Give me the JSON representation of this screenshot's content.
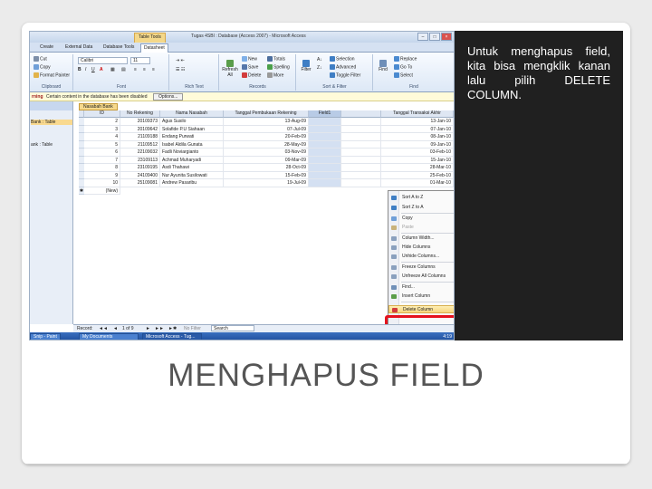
{
  "slide": {
    "description": "Untuk menghapus field, kita bisa mengklik kanan lalu pilih DELETE COLUMN.",
    "title": "MENGHAPUS FIELD"
  },
  "app": {
    "window_title": "Tugas 4SBI : Database (Access 2007) - Microsoft Access",
    "contextual_group": "Table Tools",
    "tabs": [
      "Create",
      "External Data",
      "Database Tools",
      "Datasheet"
    ],
    "ribbon": {
      "font_name": "Calibri",
      "font_size": "11",
      "groups": [
        "Clipboard",
        "Font",
        "Rich Text",
        "Records",
        "Sort & Filter",
        "Find"
      ],
      "items": {
        "cut": "Cut",
        "copy": "Copy",
        "format_painter": "Format Painter",
        "refresh": "Refresh All",
        "new": "New",
        "save": "Save",
        "delete": "Delete",
        "totals": "Totals",
        "spelling": "Spelling",
        "more": "More",
        "filter": "Filter",
        "selection": "Selection",
        "advanced": "Advanced",
        "toggle_filter": "Toggle Filter",
        "find": "Find",
        "replace": "Replace",
        "goto": "Go To",
        "select": "Select"
      }
    },
    "message_bar": {
      "warning": "rning",
      "message": "Certain content in the database has been disabled",
      "options": "Options..."
    },
    "nav_pane": {
      "items": [
        "Bank : Table",
        "ank : Table"
      ]
    },
    "doc_tab": "Nasabah Bank",
    "table": {
      "columns": [
        "ID",
        "No Rekening",
        "Nama Nasabah",
        "Tanggal Pembukaan Rekening",
        "Field1",
        "",
        "Tanggal Transaksi Akhir"
      ],
      "rows": [
        {
          "id": "2",
          "rek": "20109373",
          "nama": "Agus Susilo",
          "tgl": "13-Aug-09",
          "akhir": "13-Jan-10"
        },
        {
          "id": "3",
          "rek": "20109642",
          "nama": "Solafide P.U Siahaan",
          "tgl": "07-Jul-09",
          "akhir": "07-Jan-10"
        },
        {
          "id": "4",
          "rek": "21109188",
          "nama": "Endang Purwati",
          "tgl": "20-Feb-09",
          "akhir": "08-Jan-10"
        },
        {
          "id": "5",
          "rek": "21109512",
          "nama": "Isabel Aldila Gunata",
          "tgl": "28-May-09",
          "akhir": "09-Jan-10"
        },
        {
          "id": "6",
          "rek": "22109032",
          "nama": "Fadli Noviargianto",
          "tgl": "03-Nov-09",
          "akhir": "03-Feb-10"
        },
        {
          "id": "7",
          "rek": "23109113",
          "nama": "Achmad Muharyadi",
          "tgl": "09-Mar-09",
          "akhir": "15-Jan-10"
        },
        {
          "id": "8",
          "rek": "23109195",
          "nama": "Asdi Thahawi",
          "tgl": "28-Oct-09",
          "akhir": "28-Mar-10"
        },
        {
          "id": "9",
          "rek": "24109400",
          "nama": "Nur Ayunita Susilowati",
          "tgl": "15-Feb-09",
          "akhir": "25-Feb-10"
        },
        {
          "id": "10",
          "rek": "25109081",
          "nama": "Andrew Pasaribu",
          "tgl": "19-Jul-09",
          "akhir": "01-Mar-10"
        }
      ],
      "new_row": "(New)"
    },
    "context_menu": {
      "items": [
        {
          "label": "Sort A to Z",
          "disabled": false
        },
        {
          "label": "Sort Z to A",
          "disabled": false
        },
        {
          "label": "Copy",
          "disabled": false
        },
        {
          "label": "Paste",
          "disabled": true
        },
        {
          "label": "Column Width...",
          "disabled": false
        },
        {
          "label": "Hide Columns",
          "disabled": false
        },
        {
          "label": "Unhide Columns...",
          "disabled": false
        },
        {
          "label": "Freeze Columns",
          "disabled": false
        },
        {
          "label": "Unfreeze All Columns",
          "disabled": false
        },
        {
          "label": "Find...",
          "disabled": false
        },
        {
          "label": "Insert Column",
          "disabled": false
        },
        {
          "label": "Delete Column",
          "disabled": false
        }
      ]
    },
    "record_nav": {
      "label": "Record:",
      "position": "1 of 9",
      "filter": "No Filter",
      "search": "Search"
    },
    "taskbar": {
      "items": [
        "Snip - Paint",
        "My Documents",
        "Microsoft Access - Tug..."
      ],
      "clock": "4:19"
    },
    "colors": {
      "highlight_red": "#e5121e",
      "ribbon_blue": "#dde8f6",
      "menu_highlight": "#f8d67c"
    }
  }
}
